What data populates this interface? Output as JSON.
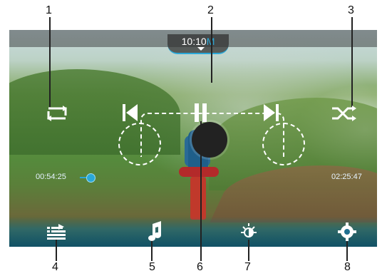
{
  "status_bar": {
    "time_prefix": "10:10",
    "time_suffix": "M"
  },
  "playback": {
    "elapsed": "00:54:25",
    "total": "02:25:47",
    "progress_fraction": 0.37
  },
  "callouts": [
    "1",
    "2",
    "3",
    "4",
    "5",
    "6",
    "7",
    "8"
  ],
  "icons": {
    "repeat": "repeat-icon",
    "shuffle": "shuffle-icon",
    "previous": "previous-track-icon",
    "pause": "pause-icon",
    "next": "next-track-icon",
    "playlist": "playlist-icon",
    "music": "music-note-icon",
    "brightness": "brightness-icon",
    "settings": "gear-icon"
  },
  "colors": {
    "accent": "#2aa8d8"
  }
}
